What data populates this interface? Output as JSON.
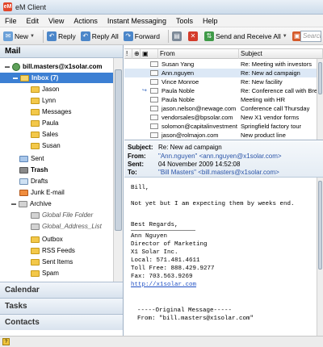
{
  "window": {
    "title": "eM Client",
    "app_icon": "eM"
  },
  "menu": [
    "File",
    "Edit",
    "View",
    "Actions",
    "Instant Messaging",
    "Tools",
    "Help"
  ],
  "toolbar": {
    "new": "New",
    "reply": "Reply",
    "reply_all": "Reply All",
    "forward": "Forward",
    "send_receive": "Send and Receive All",
    "search_placeholder": "Search"
  },
  "mail_pane": {
    "header": "Mail",
    "account": "bill.masters@x1solar.com",
    "inbox": "Inbox (7)",
    "inbox_subfolders": [
      "Jason",
      "Lynn",
      "Messages",
      "Paula",
      "Sales",
      "Susan"
    ],
    "folders": [
      "Sent",
      "Trash",
      "Drafts",
      "Junk E-mail"
    ],
    "archive": "Archive",
    "archive_children": [
      "Global File Folder",
      "Global_Address_List"
    ],
    "others": [
      "Outbox",
      "RSS Feeds",
      "Sent Items",
      "Spam"
    ]
  },
  "nav": [
    "Calendar",
    "Tasks",
    "Contacts"
  ],
  "list": {
    "columns": {
      "from": "From",
      "subject": "Subject"
    },
    "rows": [
      {
        "from": "Susan Yang",
        "subject": "Re: Meeting with investors",
        "selected": false,
        "forwarded": false
      },
      {
        "from": "Ann.nguyen",
        "subject": "Re: New ad campaign",
        "selected": true,
        "forwarded": false
      },
      {
        "from": "Vince Monroe",
        "subject": "Re: New facility",
        "selected": false,
        "forwarded": false
      },
      {
        "from": "Paula Noble",
        "subject": "Re: Conference call with Brent",
        "selected": false,
        "forwarded": true
      },
      {
        "from": "Paula Noble",
        "subject": "Meeting with HR",
        "selected": false,
        "forwarded": false
      },
      {
        "from": "jason.nelson@newage.com",
        "subject": "Conference call Thursday",
        "selected": false,
        "forwarded": false
      },
      {
        "from": "vendorsales@bpsolar.com",
        "subject": "New X1 vendor forms",
        "selected": false,
        "forwarded": false
      },
      {
        "from": "solomon@capitalinvestment.",
        "subject": "Springfield factory tour",
        "selected": false,
        "forwarded": false
      },
      {
        "from": "jason@rolmajon.com",
        "subject": "New product line",
        "selected": false,
        "forwarded": false
      }
    ]
  },
  "preview": {
    "labels": {
      "subject": "Subject:",
      "from": "From:",
      "sent": "Sent:",
      "to": "To:"
    },
    "subject": "Re: New ad campaign",
    "from": "\"Ann.nguyen\" <ann.nguyen@x1solar.com>",
    "sent": "04 November 2009 14:52:08",
    "to": "\"Bill Masters\" <bill.masters@x1solar.com>",
    "body": {
      "greeting": "Bill,",
      "line1": "Not yet but I am expecting them by weeks end.",
      "regards": "Best Regards,",
      "sig": [
        "Ann Nguyen",
        "Director of Marketing",
        "X1 Solar Inc.",
        "Local: 571.481.4611",
        "Toll Free: 888.429.9277",
        "Fax: 703.563.9269"
      ],
      "link": "http://x1solar.com",
      "original": "-----Original Message-----",
      "original_from": "From: \"bill.masters@x1solar.com\""
    }
  },
  "colors": {
    "selection": "#3c7fd3",
    "accent_link": "#1f4fc4",
    "row_highlight": "#dce8f6"
  }
}
